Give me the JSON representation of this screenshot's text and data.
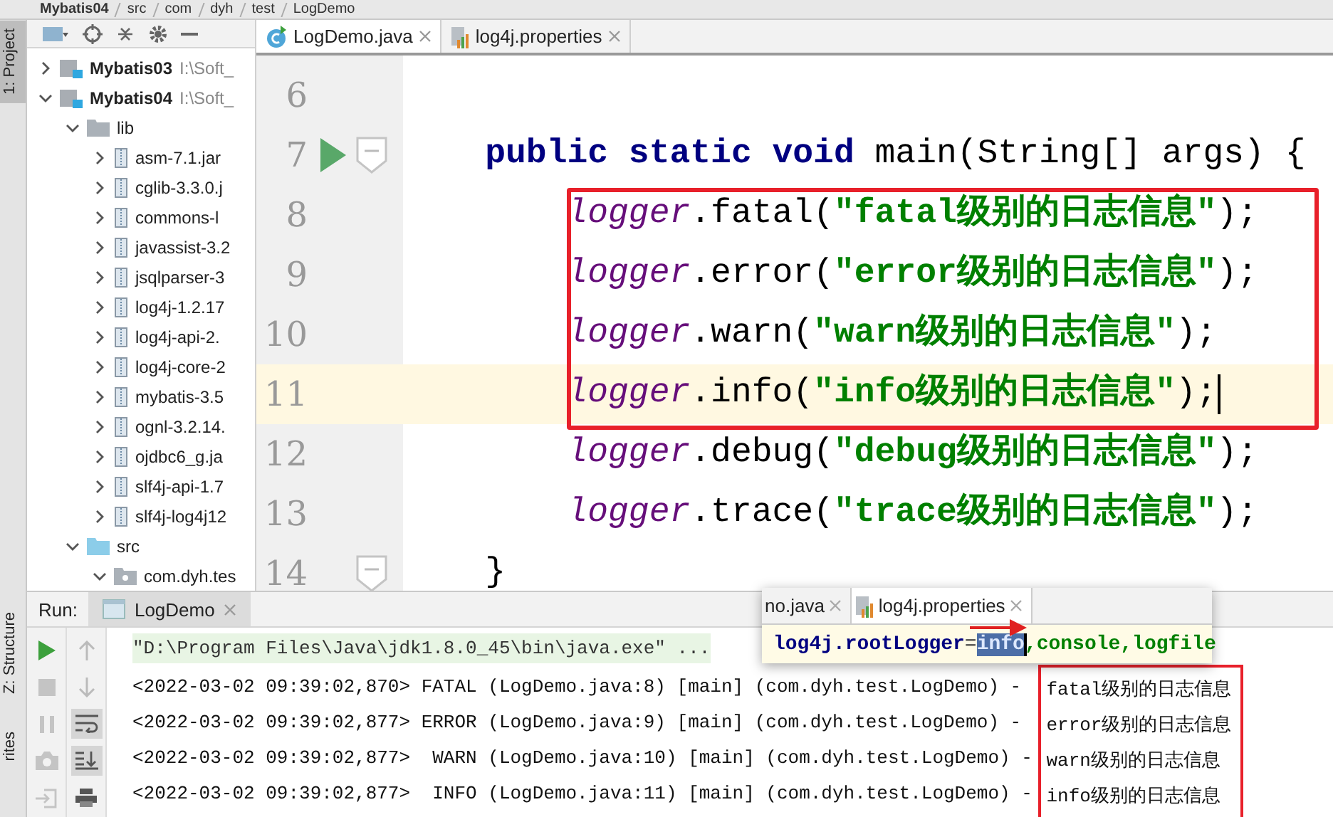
{
  "breadcrumb": [
    "Mybatis04",
    "src",
    "com",
    "dyh",
    "test",
    "LogDemo"
  ],
  "side_tabs": [
    {
      "label": "1: Project",
      "selected": true
    },
    {
      "label": "Z: Structure",
      "selected": false
    },
    {
      "label": "rites",
      "selected": false
    }
  ],
  "project_tree": [
    {
      "label": "Mybatis03",
      "path": "I:\\Soft_",
      "kind": "module",
      "expanded": false
    },
    {
      "label": "Mybatis04",
      "path": "I:\\Soft_",
      "kind": "module",
      "expanded": true,
      "children": [
        {
          "label": "lib",
          "kind": "folder",
          "expanded": true,
          "children": [
            {
              "label": "asm-7.1.jar",
              "kind": "jar",
              "expanded": false
            },
            {
              "label": "cglib-3.3.0.j",
              "kind": "jar",
              "expanded": false
            },
            {
              "label": "commons-l",
              "kind": "jar",
              "expanded": false
            },
            {
              "label": "javassist-3.2",
              "kind": "jar",
              "expanded": false
            },
            {
              "label": "jsqlparser-3",
              "kind": "jar",
              "expanded": false
            },
            {
              "label": "log4j-1.2.17",
              "kind": "jar",
              "expanded": false
            },
            {
              "label": "log4j-api-2.",
              "kind": "jar",
              "expanded": false
            },
            {
              "label": "log4j-core-2",
              "kind": "jar",
              "expanded": false
            },
            {
              "label": "mybatis-3.5",
              "kind": "jar",
              "expanded": false
            },
            {
              "label": "ognl-3.2.14.",
              "kind": "jar",
              "expanded": false
            },
            {
              "label": "ojdbc6_g.ja",
              "kind": "jar",
              "expanded": false
            },
            {
              "label": "slf4j-api-1.7",
              "kind": "jar",
              "expanded": false
            },
            {
              "label": "slf4j-log4j12",
              "kind": "jar",
              "expanded": false
            }
          ]
        },
        {
          "label": "src",
          "kind": "source",
          "expanded": true,
          "children": [
            {
              "label": "com.dyh.tes",
              "kind": "package",
              "expanded": true
            }
          ]
        }
      ]
    }
  ],
  "editor_tabs": [
    {
      "label": "LogDemo.java",
      "kind": "java",
      "selected": true
    },
    {
      "label": "log4j.properties",
      "kind": "properties",
      "selected": false
    }
  ],
  "code_lines": [
    {
      "kind": "line",
      "number": "6",
      "run_marker": false,
      "fold": false,
      "current": false
    },
    {
      "kind": "line",
      "number": "7",
      "tokens": [
        {
          "kind": "keyword",
          "text": "public static void "
        },
        {
          "kind": "plain",
          "text": "main(String[] args) {"
        }
      ],
      "run_marker": true,
      "fold": true,
      "current": false,
      "children": [
        {
          "kind": "highlight_box",
          "children": [
            {
              "kind": "line",
              "number": "8",
              "tokens": [
                {
                  "kind": "field",
                  "text": "logger"
                },
                {
                  "kind": "plain",
                  "text": ".fatal("
                },
                {
                  "kind": "string",
                  "text": "\"fatal级别的日志信息\""
                },
                {
                  "kind": "plain",
                  "text": ");"
                }
              ],
              "run_marker": false,
              "fold": false,
              "current": false
            },
            {
              "kind": "line",
              "number": "9",
              "tokens": [
                {
                  "kind": "field",
                  "text": "logger"
                },
                {
                  "kind": "plain",
                  "text": ".error("
                },
                {
                  "kind": "string",
                  "text": "\"error级别的日志信息\""
                },
                {
                  "kind": "plain",
                  "text": ");"
                }
              ],
              "run_marker": false,
              "fold": false,
              "current": false
            },
            {
              "kind": "line",
              "number": "10",
              "tokens": [
                {
                  "kind": "field",
                  "text": "logger"
                },
                {
                  "kind": "plain",
                  "text": ".warn("
                },
                {
                  "kind": "string",
                  "text": "\"warn级别的日志信息\""
                },
                {
                  "kind": "plain",
                  "text": ");"
                }
              ],
              "run_marker": false,
              "fold": false,
              "current": false
            },
            {
              "kind": "line",
              "number": "11",
              "tokens": [
                {
                  "kind": "field",
                  "text": "logger"
                },
                {
                  "kind": "plain",
                  "text": ".info("
                },
                {
                  "kind": "string",
                  "text": "\"info级别的日志信息\""
                },
                {
                  "kind": "plain",
                  "text": ");"
                }
              ],
              "run_marker": false,
              "fold": false,
              "current": true
            }
          ]
        },
        {
          "kind": "line",
          "number": "12",
          "tokens": [
            {
              "kind": "field",
              "text": "logger"
            },
            {
              "kind": "plain",
              "text": ".debug("
            },
            {
              "kind": "string",
              "text": "\"debug级别的日志信息\""
            },
            {
              "kind": "plain",
              "text": ");"
            }
          ],
          "run_marker": false,
          "fold": false,
          "current": false
        },
        {
          "kind": "line",
          "number": "13",
          "tokens": [
            {
              "kind": "field",
              "text": "logger"
            },
            {
              "kind": "plain",
              "text": ".trace("
            },
            {
              "kind": "string",
              "text": "\"trace级别的日志信息\""
            },
            {
              "kind": "plain",
              "text": ");"
            }
          ],
          "run_marker": false,
          "fold": false,
          "current": false
        }
      ]
    },
    {
      "kind": "line",
      "number": "14",
      "tokens": [
        {
          "kind": "plain",
          "text": "}"
        }
      ],
      "run_marker": false,
      "fold": true,
      "current": false
    }
  ],
  "run_panel": {
    "title": "Run:",
    "tab": "LogDemo",
    "left_actions": [
      {
        "kind": "rerun",
        "disabled": false
      },
      {
        "kind": "stop",
        "disabled": true
      },
      {
        "kind": "pause",
        "disabled": true
      },
      {
        "kind": "camera",
        "disabled": true
      },
      {
        "kind": "exit",
        "disabled": true
      }
    ],
    "right_actions": [
      {
        "kind": "up",
        "selected": false
      },
      {
        "kind": "down",
        "selected": false
      },
      {
        "kind": "wrap",
        "selected": true
      },
      {
        "kind": "scroll_end",
        "selected": true
      },
      {
        "kind": "print",
        "selected": false
      }
    ],
    "command": "\"D:\\Program Files\\Java\\jdk1.8.0_45\\bin\\java.exe\" ...",
    "log_lines": [
      {
        "prefix": "<2022-03-02 09:39:02,870> FATAL (LogDemo.java:8) [main] (com.dyh.test.LogDemo) - ",
        "message": "fatal级别的日志信息"
      },
      {
        "prefix": "<2022-03-02 09:39:02,877> ERROR (LogDemo.java:9) [main] (com.dyh.test.LogDemo) - ",
        "message": "error级别的日志信息"
      },
      {
        "prefix": "<2022-03-02 09:39:02,877>  WARN (LogDemo.java:10) [main] (com.dyh.test.LogDemo) - ",
        "message": "warn级别的日志信息"
      },
      {
        "prefix": "<2022-03-02 09:39:02,877>  INFO (LogDemo.java:11) [main] (com.dyh.test.LogDemo) - ",
        "message": "info级别的日志信息"
      }
    ],
    "messages_boxed": true
  },
  "popup": {
    "tabs": [
      {
        "label": "no.java",
        "selected": false
      },
      {
        "label": "log4j.properties",
        "selected": true
      }
    ],
    "key": "log4j.rootLogger",
    "equals": "=",
    "selected_value": "info",
    "rest": ",console,logfile",
    "arrow": true
  }
}
